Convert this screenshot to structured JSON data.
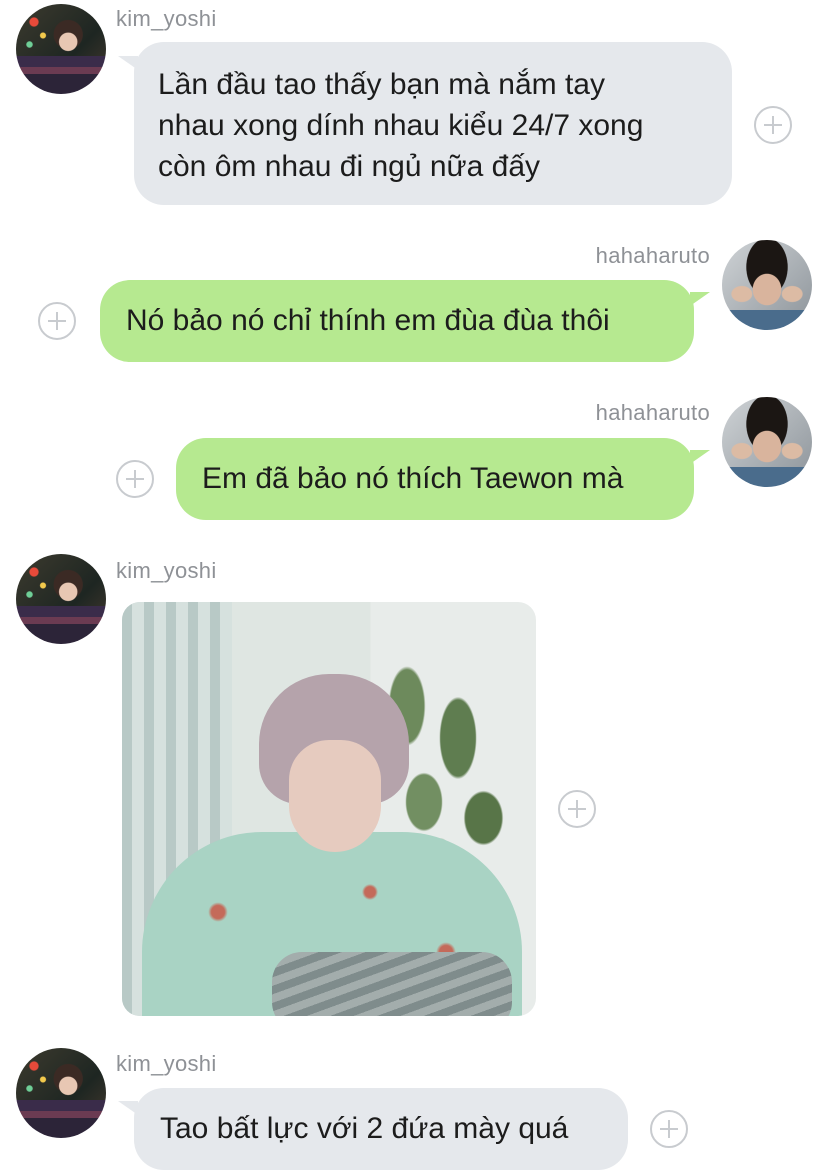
{
  "messages": [
    {
      "sender": "kim_yoshi",
      "direction": "incoming",
      "lines": [
        "Lần đầu tao thấy bạn mà nắm tay",
        "nhau xong dính nhau kiểu 24/7 xong",
        "còn ôm nhau đi ngủ nữa đấy"
      ]
    },
    {
      "sender": "hahaharuto",
      "direction": "outgoing",
      "text": "Nó bảo nó chỉ thính em đùa đùa thôi"
    },
    {
      "sender": "hahaharuto",
      "direction": "outgoing",
      "text": "Em đã bảo nó thích Taewon mà"
    },
    {
      "sender": "kim_yoshi",
      "direction": "incoming",
      "type": "photo",
      "photo_description": "photo"
    },
    {
      "sender": "kim_yoshi",
      "direction": "incoming",
      "text": "Tao bất lực với 2 đứa mày quá"
    }
  ],
  "colors": {
    "incoming_bubble": "#e5e8ec",
    "outgoing_bubble": "#b6e990",
    "username": "#8e9196",
    "plus_icon": "#c8cbcf"
  }
}
